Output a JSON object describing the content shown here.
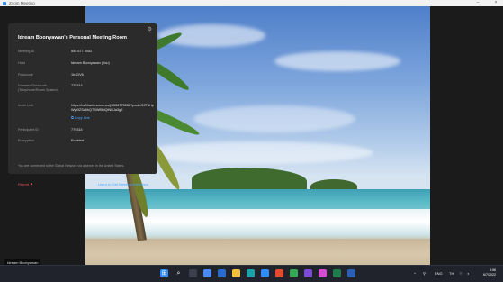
{
  "window": {
    "title": "Zoom Meeting",
    "minimize": "–",
    "close": "×"
  },
  "panel": {
    "heading": "Idream Boonyawan's Personal Meeting Room",
    "rows": [
      {
        "label": "Meeting ID",
        "value": "555 677 5052"
      },
      {
        "label": "Host",
        "value": "Idream Boonyawan (You)"
      },
      {
        "label": "Passcode",
        "value": "1h4DV6"
      },
      {
        "label": "Numeric Passcode (Telephone/Room System)",
        "value": "779314"
      },
      {
        "label": "Invite Link",
        "value": "https://us04web.zoom.us/j/5556775052?pwd=OZTdHpWyXIZSz6bQTBWfl5dQtNDJa3g9"
      },
      {
        "label": "Participant ID",
        "value": "779314"
      },
      {
        "label": "Encryption",
        "value": "Enabled"
      }
    ],
    "copy_link": "Copy Link",
    "notice": "You are connected to the Global Network via a server in the United States.",
    "report": "Report",
    "upgrade": "Learn to Get Meeting Extension"
  },
  "caption": "Idream Boonyawan",
  "taskbar": {
    "tray": [
      "ENG",
      "TH"
    ],
    "time": "9:56",
    "date": "6/7/2022"
  },
  "colors": {
    "accent": "#4aa3ff",
    "report": "#e35a5a",
    "panel_bg": "#2b2b2b"
  }
}
